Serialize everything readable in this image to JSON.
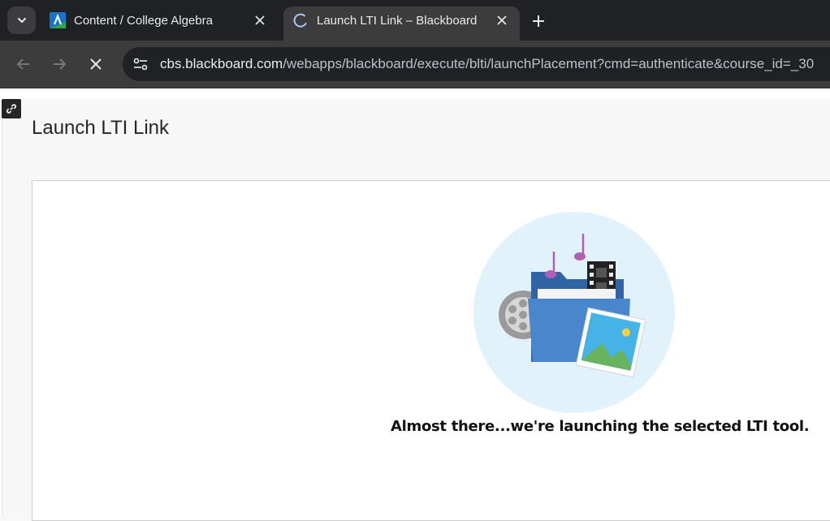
{
  "browser": {
    "tabs": [
      {
        "title": "Content / College Algebra",
        "active": false,
        "favicon": "aleks-logo-icon"
      },
      {
        "title": "Launch LTI Link – Blackboard",
        "active": true,
        "favicon": "loading-spinner-icon"
      }
    ],
    "url": {
      "host": "cbs.blackboard.com",
      "path": "/webapps/blackboard/execute/blti/launchPlacement?cmd=authenticate&course_id=_30"
    }
  },
  "page": {
    "title": "Launch LTI Link",
    "message": "Almost there...we're launching the selected LTI tool."
  },
  "colors": {
    "tab_strip": "#202124",
    "toolbar": "#3c3c3c",
    "illustration_bg": "#e2f2fb",
    "folder_blue": "#3f7cc2",
    "music_note": "#b05fb1"
  }
}
